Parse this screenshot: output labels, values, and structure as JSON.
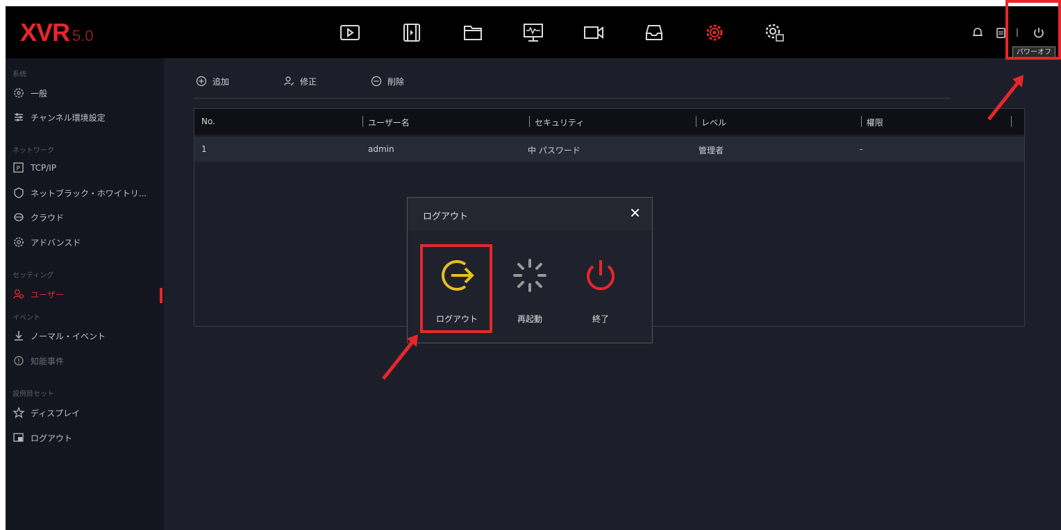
{
  "app": {
    "logo": "XVR",
    "version": "5.0"
  },
  "topnav": {
    "icons": [
      "playback-icon",
      "video-clip-icon",
      "folder-icon",
      "monitor-icon",
      "camera-icon",
      "storage-icon",
      "settings-gear-icon",
      "system-gear-icon"
    ],
    "active": "settings-gear-icon",
    "right": [
      "bell-icon",
      "screen-icon",
      "power-icon"
    ],
    "tooltip": "パワーオフ"
  },
  "sidebar": {
    "sections": [
      {
        "label": "系统",
        "items": [
          {
            "label": "一般"
          },
          {
            "label": "チャンネル環境設定"
          }
        ]
      },
      {
        "label": "ネットワーク",
        "items": [
          {
            "label": "TCP/IP"
          },
          {
            "label": "ネットブラック・ホワイトリ..."
          },
          {
            "label": "クラウド"
          },
          {
            "label": "アドバンスド"
          }
        ]
      },
      {
        "label": "セッティング",
        "items": [
          {
            "label": "ユーザー"
          }
        ]
      },
      {
        "label": "イベント",
        "items": [
          {
            "label": "ノーマル・イベント"
          },
          {
            "label": "知能事件"
          }
        ]
      },
      {
        "label": "設例目セット",
        "items": [
          {
            "label": "ディスプレイ"
          },
          {
            "label": "ログアウト"
          }
        ]
      }
    ]
  },
  "toolbar": {
    "add": "追加",
    "edit": "修正",
    "delete": "削除"
  },
  "table": {
    "headers": [
      "No.",
      "ユーザー名",
      "セキュリティ",
      "レベル",
      "權限"
    ],
    "rows": [
      [
        "1",
        "admin",
        "中 パスワード",
        "管理者",
        "-"
      ]
    ]
  },
  "dialog": {
    "title": "ログアウト",
    "options": [
      {
        "label": "ログアウト"
      },
      {
        "label": "再起動"
      },
      {
        "label": "終了"
      }
    ]
  },
  "colors": {
    "accent": "#e8262b",
    "logout_icon": "#e6c020",
    "annotation": "#e8262b"
  }
}
